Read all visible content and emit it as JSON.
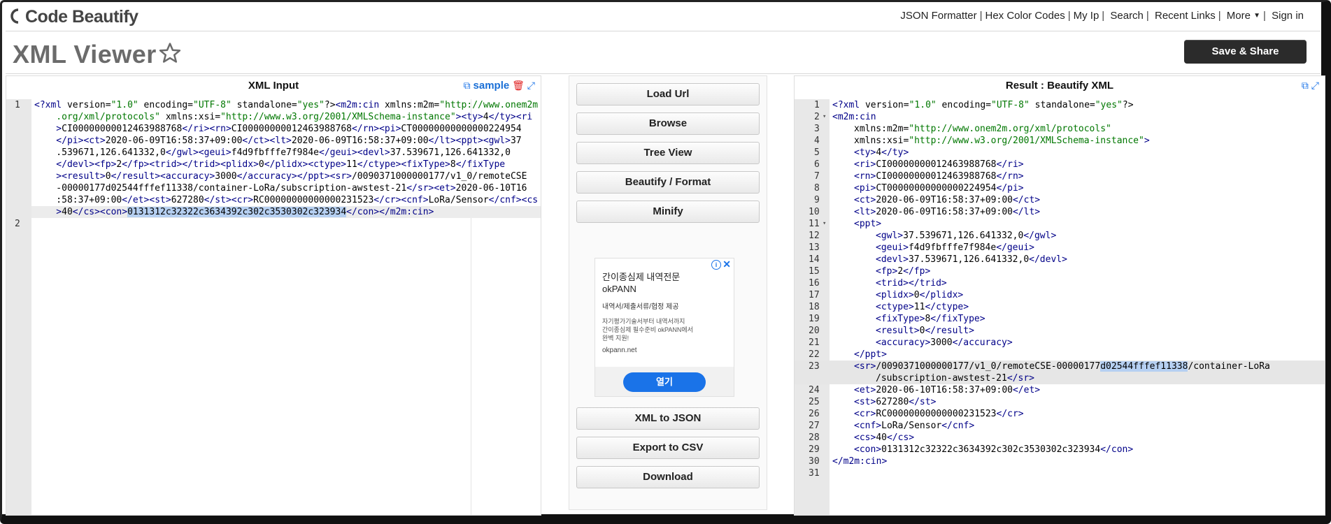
{
  "header": {
    "logo_text": "Code Beautify",
    "nav": [
      "JSON Formatter",
      "Hex Color Codes",
      "My Ip",
      "Search",
      "Recent Links",
      "More",
      "Sign in"
    ]
  },
  "page": {
    "title": "XML Viewer",
    "save_label": "Save & Share"
  },
  "left_panel": {
    "title": "XML Input",
    "sample_label": "sample",
    "line_numbers": [
      "1",
      "2"
    ],
    "wrapped_rows": [
      [
        {
          "t": "<?",
          "c": "pi"
        },
        {
          "t": "xml",
          "c": "tg"
        },
        {
          "t": " version=",
          "c": ""
        },
        {
          "t": "\"1.0\"",
          "c": "av"
        },
        {
          "t": " encoding=",
          "c": ""
        },
        {
          "t": "\"UTF-8\"",
          "c": "av"
        },
        {
          "t": " standalone=",
          "c": ""
        },
        {
          "t": "\"yes\"",
          "c": "av"
        },
        {
          "t": "?>",
          "c": ""
        },
        {
          "t": "<m2m:cin",
          "c": "tg"
        },
        {
          "t": " xmlns:m2m=",
          "c": ""
        },
        {
          "t": "\"http://www.onem2m",
          "c": "av"
        }
      ],
      [
        {
          "t": "    .org/xml/protocols\"",
          "c": "av"
        },
        {
          "t": " xmlns:xsi=",
          "c": ""
        },
        {
          "t": "\"http://www.w3.org/2001/XMLSchema-instance\"",
          "c": "av"
        },
        {
          "t": ">",
          "c": "tg"
        },
        {
          "t": "<ty>",
          "c": "tg"
        },
        {
          "t": "4",
          "c": ""
        },
        {
          "t": "</ty><ri",
          "c": "tg"
        }
      ],
      [
        {
          "t": "    >",
          "c": "tg"
        },
        {
          "t": "CI00000000012463988768",
          "c": ""
        },
        {
          "t": "</ri><rn>",
          "c": "tg"
        },
        {
          "t": "CI00000000012463988768",
          "c": ""
        },
        {
          "t": "</rn><pi>",
          "c": "tg"
        },
        {
          "t": "CT00000000000000224954",
          "c": ""
        }
      ],
      [
        {
          "t": "    </pi><ct>",
          "c": "tg"
        },
        {
          "t": "2020-06-09T16:58:37+09:00",
          "c": ""
        },
        {
          "t": "</ct><lt>",
          "c": "tg"
        },
        {
          "t": "2020-06-09T16:58:37+09:00",
          "c": ""
        },
        {
          "t": "</lt><ppt><gwl>",
          "c": "tg"
        },
        {
          "t": "37",
          "c": ""
        }
      ],
      [
        {
          "t": "    .539671,126.641332,0",
          "c": ""
        },
        {
          "t": "</gwl><geui>",
          "c": "tg"
        },
        {
          "t": "f4d9fbfffe7f984e",
          "c": ""
        },
        {
          "t": "</geui><devl>",
          "c": "tg"
        },
        {
          "t": "37.539671,126.641332,0",
          "c": ""
        }
      ],
      [
        {
          "t": "    </devl><fp>",
          "c": "tg"
        },
        {
          "t": "2",
          "c": ""
        },
        {
          "t": "</fp><trid></trid><plidx>",
          "c": "tg"
        },
        {
          "t": "0",
          "c": ""
        },
        {
          "t": "</plidx><ctype>",
          "c": "tg"
        },
        {
          "t": "11",
          "c": ""
        },
        {
          "t": "</ctype><fixType>",
          "c": "tg"
        },
        {
          "t": "8",
          "c": ""
        },
        {
          "t": "</fixType",
          "c": "tg"
        }
      ],
      [
        {
          "t": "    ><result>",
          "c": "tg"
        },
        {
          "t": "0",
          "c": ""
        },
        {
          "t": "</result><accuracy>",
          "c": "tg"
        },
        {
          "t": "3000",
          "c": ""
        },
        {
          "t": "</accuracy></ppt><sr>",
          "c": "tg"
        },
        {
          "t": "/0090371000000177/v1_0/remoteCSE",
          "c": ""
        }
      ],
      [
        {
          "t": "    -00000177d02544fffef11338/container-LoRa/subscription-awstest-21",
          "c": ""
        },
        {
          "t": "</sr><et>",
          "c": "tg"
        },
        {
          "t": "2020-06-10T16",
          "c": ""
        }
      ],
      [
        {
          "t": "    :58:37+09:00",
          "c": ""
        },
        {
          "t": "</et><st>",
          "c": "tg"
        },
        {
          "t": "627280",
          "c": ""
        },
        {
          "t": "</st><cr>",
          "c": "tg"
        },
        {
          "t": "RC00000000000000231523",
          "c": ""
        },
        {
          "t": "</cr><cnf>",
          "c": "tg"
        },
        {
          "t": "LoRa/Sensor",
          "c": ""
        },
        {
          "t": "</cnf><cs",
          "c": "tg"
        }
      ],
      [
        {
          "t": "    >",
          "c": "tg"
        },
        {
          "t": "40",
          "c": ""
        },
        {
          "t": "</cs><con>",
          "c": "tg"
        },
        {
          "t": "0131312c32322c3634392c302c3530302c323934",
          "c": "sel"
        },
        {
          "t": "</con></m2m:cin>",
          "c": "tg"
        }
      ]
    ]
  },
  "middle_panel": {
    "buttons": [
      "Load Url",
      "Browse",
      "Tree View",
      "Beautify / Format",
      "Minify",
      "XML to JSON",
      "Export to CSV",
      "Download"
    ],
    "ad": {
      "title_line1": "간이종심제 내역전문",
      "title_line2": "okPANN",
      "subtitle": "내역서/제출서류/협정 제공",
      "desc_line1": "자기평가기술서부터 내역서까지",
      "desc_line2": "간이종심제 필수준비 okPANN에서",
      "desc_line3": "완벽 지원!",
      "url": "okpann.net",
      "cta": "열기"
    }
  },
  "right_panel": {
    "title": "Result : Beautify XML",
    "lines": [
      {
        "n": "1",
        "fold": false,
        "ind": 0,
        "parts": [
          {
            "t": "<?",
            "c": "pi"
          },
          {
            "t": "xml",
            "c": "tg"
          },
          {
            "t": " version=",
            "c": ""
          },
          {
            "t": "\"1.0\"",
            "c": "av"
          },
          {
            "t": " encoding=",
            "c": ""
          },
          {
            "t": "\"UTF-8\"",
            "c": "av"
          },
          {
            "t": " standalone=",
            "c": ""
          },
          {
            "t": "\"yes\"",
            "c": "av"
          },
          {
            "t": "?>",
            "c": ""
          }
        ]
      },
      {
        "n": "2",
        "fold": true,
        "ind": 0,
        "parts": [
          {
            "t": "<m2m:cin",
            "c": "tg"
          }
        ]
      },
      {
        "n": "3",
        "fold": false,
        "ind": 1,
        "parts": [
          {
            "t": "xmlns:m2m=",
            "c": ""
          },
          {
            "t": "\"http://www.onem2m.org/xml/protocols\"",
            "c": "av"
          }
        ]
      },
      {
        "n": "4",
        "fold": false,
        "ind": 1,
        "parts": [
          {
            "t": "xmlns:xsi=",
            "c": ""
          },
          {
            "t": "\"http://www.w3.org/2001/XMLSchema-instance\"",
            "c": "av"
          },
          {
            "t": ">",
            "c": "tg"
          }
        ]
      },
      {
        "n": "5",
        "fold": false,
        "ind": 1,
        "parts": [
          {
            "t": "<ty>",
            "c": "tg"
          },
          {
            "t": "4",
            "c": ""
          },
          {
            "t": "</ty>",
            "c": "tg"
          }
        ]
      },
      {
        "n": "6",
        "fold": false,
        "ind": 1,
        "parts": [
          {
            "t": "<ri>",
            "c": "tg"
          },
          {
            "t": "CI00000000012463988768",
            "c": ""
          },
          {
            "t": "</ri>",
            "c": "tg"
          }
        ]
      },
      {
        "n": "7",
        "fold": false,
        "ind": 1,
        "parts": [
          {
            "t": "<rn>",
            "c": "tg"
          },
          {
            "t": "CI00000000012463988768",
            "c": ""
          },
          {
            "t": "</rn>",
            "c": "tg"
          }
        ]
      },
      {
        "n": "8",
        "fold": false,
        "ind": 1,
        "parts": [
          {
            "t": "<pi>",
            "c": "tg"
          },
          {
            "t": "CT00000000000000224954",
            "c": ""
          },
          {
            "t": "</pi>",
            "c": "tg"
          }
        ]
      },
      {
        "n": "9",
        "fold": false,
        "ind": 1,
        "parts": [
          {
            "t": "<ct>",
            "c": "tg"
          },
          {
            "t": "2020-06-09T16:58:37+09:00",
            "c": ""
          },
          {
            "t": "</ct>",
            "c": "tg"
          }
        ]
      },
      {
        "n": "10",
        "fold": false,
        "ind": 1,
        "parts": [
          {
            "t": "<lt>",
            "c": "tg"
          },
          {
            "t": "2020-06-09T16:58:37+09:00",
            "c": ""
          },
          {
            "t": "</lt>",
            "c": "tg"
          }
        ]
      },
      {
        "n": "11",
        "fold": true,
        "ind": 1,
        "parts": [
          {
            "t": "<ppt>",
            "c": "tg"
          }
        ]
      },
      {
        "n": "12",
        "fold": false,
        "ind": 2,
        "parts": [
          {
            "t": "<gwl>",
            "c": "tg"
          },
          {
            "t": "37.539671,126.641332,0",
            "c": ""
          },
          {
            "t": "</gwl>",
            "c": "tg"
          }
        ]
      },
      {
        "n": "13",
        "fold": false,
        "ind": 2,
        "parts": [
          {
            "t": "<geui>",
            "c": "tg"
          },
          {
            "t": "f4d9fbfffe7f984e",
            "c": ""
          },
          {
            "t": "</geui>",
            "c": "tg"
          }
        ]
      },
      {
        "n": "14",
        "fold": false,
        "ind": 2,
        "parts": [
          {
            "t": "<devl>",
            "c": "tg"
          },
          {
            "t": "37.539671,126.641332,0",
            "c": ""
          },
          {
            "t": "</devl>",
            "c": "tg"
          }
        ]
      },
      {
        "n": "15",
        "fold": false,
        "ind": 2,
        "parts": [
          {
            "t": "<fp>",
            "c": "tg"
          },
          {
            "t": "2",
            "c": ""
          },
          {
            "t": "</fp>",
            "c": "tg"
          }
        ]
      },
      {
        "n": "16",
        "fold": false,
        "ind": 2,
        "parts": [
          {
            "t": "<trid></trid>",
            "c": "tg"
          }
        ]
      },
      {
        "n": "17",
        "fold": false,
        "ind": 2,
        "parts": [
          {
            "t": "<plidx>",
            "c": "tg"
          },
          {
            "t": "0",
            "c": ""
          },
          {
            "t": "</plidx>",
            "c": "tg"
          }
        ]
      },
      {
        "n": "18",
        "fold": false,
        "ind": 2,
        "parts": [
          {
            "t": "<ctype>",
            "c": "tg"
          },
          {
            "t": "11",
            "c": ""
          },
          {
            "t": "</ctype>",
            "c": "tg"
          }
        ]
      },
      {
        "n": "19",
        "fold": false,
        "ind": 2,
        "parts": [
          {
            "t": "<fixType>",
            "c": "tg"
          },
          {
            "t": "8",
            "c": ""
          },
          {
            "t": "</fixType>",
            "c": "tg"
          }
        ]
      },
      {
        "n": "20",
        "fold": false,
        "ind": 2,
        "parts": [
          {
            "t": "<result>",
            "c": "tg"
          },
          {
            "t": "0",
            "c": ""
          },
          {
            "t": "</result>",
            "c": "tg"
          }
        ]
      },
      {
        "n": "21",
        "fold": false,
        "ind": 2,
        "parts": [
          {
            "t": "<accuracy>",
            "c": "tg"
          },
          {
            "t": "3000",
            "c": ""
          },
          {
            "t": "</accuracy>",
            "c": "tg"
          }
        ]
      },
      {
        "n": "22",
        "fold": false,
        "ind": 1,
        "parts": [
          {
            "t": "</ppt>",
            "c": "tg"
          }
        ]
      },
      {
        "n": "23",
        "fold": false,
        "ind": 1,
        "hl": true,
        "parts": [
          {
            "t": "<sr>",
            "c": "tg"
          },
          {
            "t": "/0090371000000177/v1_0/remoteCSE-00000177",
            "c": ""
          },
          {
            "t": "d02544fffef11338",
            "c": "sel"
          },
          {
            "t": "/container-LoRa",
            "c": ""
          }
        ]
      },
      {
        "n": "",
        "fold": false,
        "ind": 2,
        "hl": true,
        "parts": [
          {
            "t": "/subscription-awstest-21",
            "c": ""
          },
          {
            "t": "</sr>",
            "c": "tg"
          }
        ]
      },
      {
        "n": "24",
        "fold": false,
        "ind": 1,
        "parts": [
          {
            "t": "<et>",
            "c": "tg"
          },
          {
            "t": "2020-06-10T16:58:37+09:00",
            "c": ""
          },
          {
            "t": "</et>",
            "c": "tg"
          }
        ]
      },
      {
        "n": "25",
        "fold": false,
        "ind": 1,
        "parts": [
          {
            "t": "<st>",
            "c": "tg"
          },
          {
            "t": "627280",
            "c": ""
          },
          {
            "t": "</st>",
            "c": "tg"
          }
        ]
      },
      {
        "n": "26",
        "fold": false,
        "ind": 1,
        "parts": [
          {
            "t": "<cr>",
            "c": "tg"
          },
          {
            "t": "RC00000000000000231523",
            "c": ""
          },
          {
            "t": "</cr>",
            "c": "tg"
          }
        ]
      },
      {
        "n": "27",
        "fold": false,
        "ind": 1,
        "parts": [
          {
            "t": "<cnf>",
            "c": "tg"
          },
          {
            "t": "LoRa/Sensor",
            "c": ""
          },
          {
            "t": "</cnf>",
            "c": "tg"
          }
        ]
      },
      {
        "n": "28",
        "fold": false,
        "ind": 1,
        "parts": [
          {
            "t": "<cs>",
            "c": "tg"
          },
          {
            "t": "40",
            "c": ""
          },
          {
            "t": "</cs>",
            "c": "tg"
          }
        ]
      },
      {
        "n": "29",
        "fold": false,
        "ind": 1,
        "parts": [
          {
            "t": "<con>",
            "c": "tg"
          },
          {
            "t": "0131312c32322c3634392c302c3530302c323934",
            "c": ""
          },
          {
            "t": "</con>",
            "c": "tg"
          }
        ]
      },
      {
        "n": "30",
        "fold": false,
        "ind": 0,
        "parts": [
          {
            "t": "</m2m:cin>",
            "c": "tg"
          }
        ]
      },
      {
        "n": "31",
        "fold": false,
        "ind": 0,
        "parts": []
      }
    ]
  }
}
